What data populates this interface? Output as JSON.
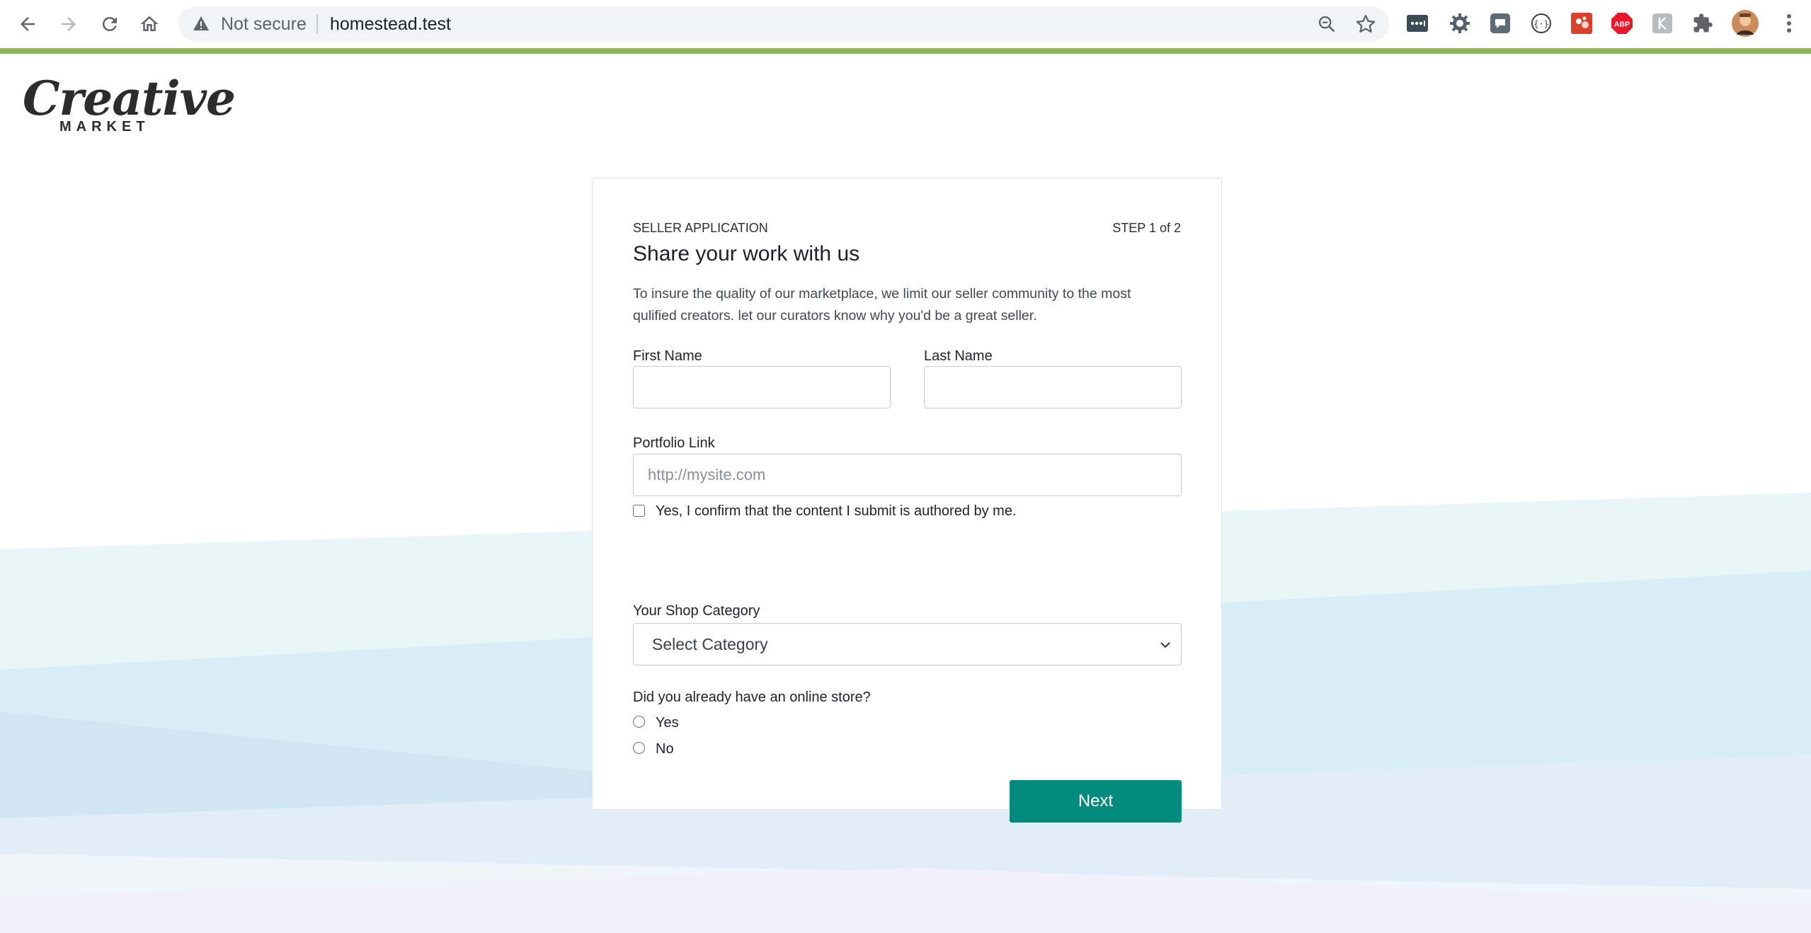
{
  "browser": {
    "security_label": "Not secure",
    "url": "homestead.test",
    "extensions": [
      "password-manager-icon",
      "gear-extension-icon",
      "speech-extension-icon",
      "code-extension-icon",
      "red-extension-icon",
      "adblock-plus-icon",
      "gray-extension-icon",
      "puzzle-extensions-icon"
    ],
    "adblock_label": "ABP"
  },
  "brand": {
    "logo_script": "Creative",
    "logo_sub": "MARKET"
  },
  "form": {
    "eyebrow": "SELLER APPLICATION",
    "step": "STEP 1 of 2",
    "title": "Share your work with us",
    "description": "To insure the quality of our marketplace, we limit our seller community to the most qulified creators. let our curators know why you'd be a great seller.",
    "first_name_label": "First Name",
    "first_name_value": "",
    "last_name_label": "Last Name",
    "last_name_value": "",
    "portfolio_label": "Portfolio Link",
    "portfolio_placeholder": "http://mysite.com",
    "confirm_label": "Yes, I confirm that the content I submit is authored by me.",
    "confirm_checked": false,
    "category_label": "Your Shop Category",
    "category_selected": "Select Category",
    "store_question": "Did you already have an online store?",
    "store_options": [
      "Yes",
      "No"
    ],
    "next_label": "Next"
  },
  "colors": {
    "accent_bar": "#8fb55c",
    "button": "#008b7e"
  }
}
